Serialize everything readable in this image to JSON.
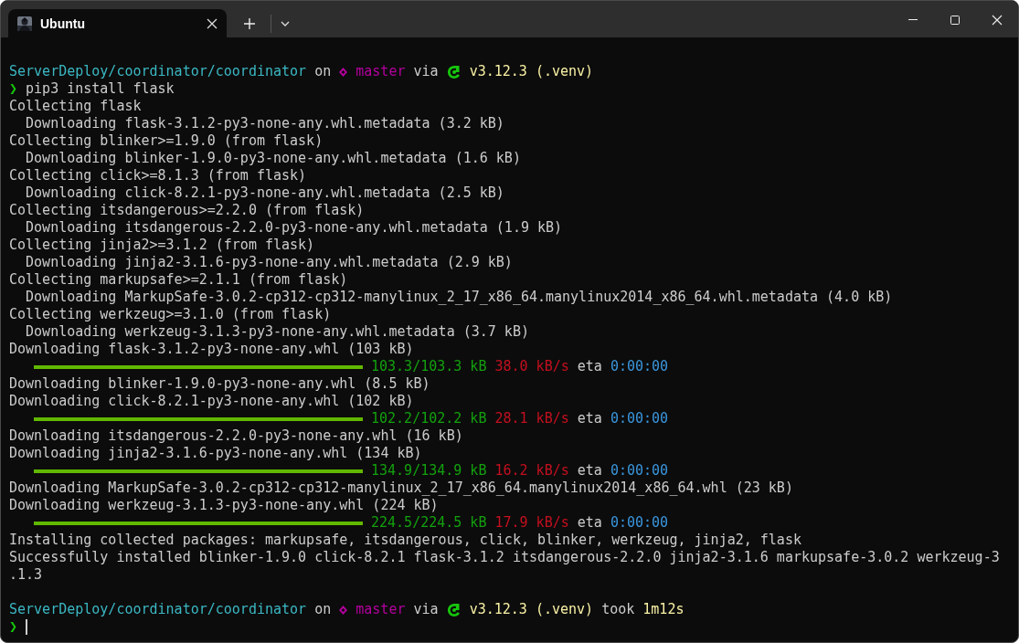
{
  "tabs": [
    {
      "title": "Ubuntu",
      "selected": true
    }
  ],
  "terminal": {
    "lines": [
      {
        "kind": "prompt",
        "path": "ServerDeploy/coordinator/coordinator",
        "on": "on",
        "branch": "master",
        "via": "via",
        "version": "v3.12.3 (.venv)"
      },
      {
        "kind": "command",
        "symbol": "❯",
        "text": "pip3 install flask"
      },
      {
        "kind": "text",
        "text": "Collecting flask"
      },
      {
        "kind": "text",
        "text": "  Downloading flask-3.1.2-py3-none-any.whl.metadata (3.2 kB)"
      },
      {
        "kind": "text",
        "text": "Collecting blinker>=1.9.0 (from flask)"
      },
      {
        "kind": "text",
        "text": "  Downloading blinker-1.9.0-py3-none-any.whl.metadata (1.6 kB)"
      },
      {
        "kind": "text",
        "text": "Collecting click>=8.1.3 (from flask)"
      },
      {
        "kind": "text",
        "text": "  Downloading click-8.2.1-py3-none-any.whl.metadata (2.5 kB)"
      },
      {
        "kind": "text",
        "text": "Collecting itsdangerous>=2.2.0 (from flask)"
      },
      {
        "kind": "text",
        "text": "  Downloading itsdangerous-2.2.0-py3-none-any.whl.metadata (1.9 kB)"
      },
      {
        "kind": "text",
        "text": "Collecting jinja2>=3.1.2 (from flask)"
      },
      {
        "kind": "text",
        "text": "  Downloading jinja2-3.1.6-py3-none-any.whl.metadata (2.9 kB)"
      },
      {
        "kind": "text",
        "text": "Collecting markupsafe>=2.1.1 (from flask)"
      },
      {
        "kind": "text",
        "text": "  Downloading MarkupSafe-3.0.2-cp312-cp312-manylinux_2_17_x86_64.manylinux2014_x86_64.whl.metadata (4.0 kB)"
      },
      {
        "kind": "text",
        "text": "Collecting werkzeug>=3.1.0 (from flask)"
      },
      {
        "kind": "text",
        "text": "  Downloading werkzeug-3.1.3-py3-none-any.whl.metadata (3.7 kB)"
      },
      {
        "kind": "text",
        "text": "Downloading flask-3.1.2-py3-none-any.whl (103 kB)"
      },
      {
        "kind": "progress",
        "level": 1,
        "size": "103.3/103.3 kB",
        "speed": "38.0 kB/s",
        "eta_label": "eta",
        "eta": "0:00:00"
      },
      {
        "kind": "text",
        "text": "Downloading blinker-1.9.0-py3-none-any.whl (8.5 kB)"
      },
      {
        "kind": "text",
        "text": "Downloading click-8.2.1-py3-none-any.whl (102 kB)"
      },
      {
        "kind": "progress",
        "level": 1,
        "size": "102.2/102.2 kB",
        "speed": "28.1 kB/s",
        "eta_label": "eta",
        "eta": "0:00:00"
      },
      {
        "kind": "text",
        "text": "Downloading itsdangerous-2.2.0-py3-none-any.whl (16 kB)"
      },
      {
        "kind": "text",
        "text": "Downloading jinja2-3.1.6-py3-none-any.whl (134 kB)"
      },
      {
        "kind": "progress",
        "level": 1,
        "size": "134.9/134.9 kB",
        "speed": "16.2 kB/s",
        "eta_label": "eta",
        "eta": "0:00:00"
      },
      {
        "kind": "text",
        "text": "Downloading MarkupSafe-3.0.2-cp312-cp312-manylinux_2_17_x86_64.manylinux2014_x86_64.whl (23 kB)"
      },
      {
        "kind": "text",
        "text": "Downloading werkzeug-3.1.3-py3-none-any.whl (224 kB)"
      },
      {
        "kind": "progress",
        "level": 1,
        "size": "224.5/224.5 kB",
        "speed": "17.9 kB/s",
        "eta_label": "eta",
        "eta": "0:00:00"
      },
      {
        "kind": "text",
        "text": "Installing collected packages: markupsafe, itsdangerous, click, blinker, werkzeug, jinja2, flask"
      },
      {
        "kind": "text",
        "text": "Successfully installed blinker-1.9.0 click-8.2.1 flask-3.1.2 itsdangerous-2.2.0 jinja2-3.1.6 markupsafe-3.0.2 werkzeug-3"
      },
      {
        "kind": "text",
        "text": ".1.3"
      },
      {
        "kind": "blank"
      },
      {
        "kind": "prompt",
        "path": "ServerDeploy/coordinator/coordinator",
        "on": "on",
        "branch": "master",
        "via": "via",
        "version": "v3.12.3 (.venv)",
        "took_label": "took",
        "took": "1m12s"
      },
      {
        "kind": "input",
        "symbol": "❯"
      }
    ]
  }
}
